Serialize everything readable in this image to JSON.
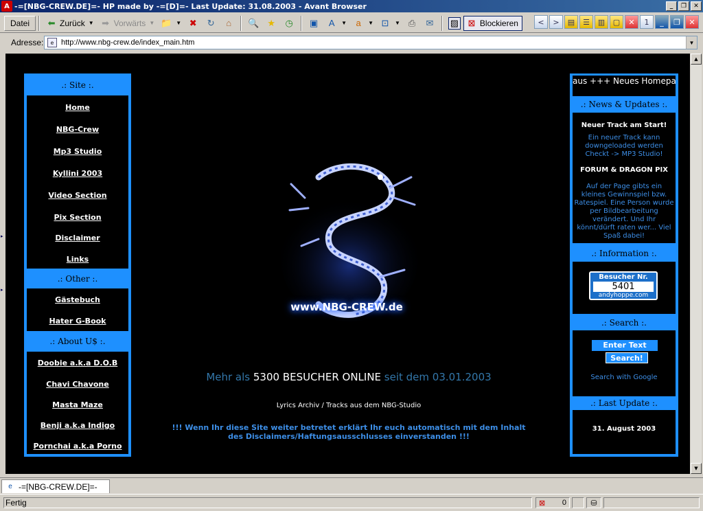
{
  "window": {
    "title": "-=[NBG-CREW.DE]=- HP made by -=[D]=- Last Update: 31.08.2003 - Avant Browser"
  },
  "toolbar": {
    "file_menu": "Datei",
    "back_label": "Zurück",
    "forward_label": "Vorwärts",
    "blocker_label": "Blockieren"
  },
  "address": {
    "label": "Adresse:",
    "url": "http://www.nbg-crew.de/index_main.htm"
  },
  "left_nav": {
    "site_header": ".: Site :.",
    "site_links": [
      "Home",
      "NBG-Crew",
      "Mp3 Studio",
      "Kyllini 2003",
      "Video Section",
      "Pix Section",
      "Disclaimer",
      "Links"
    ],
    "other_header": ".: Other :.",
    "other_links": [
      "Gästebuch",
      "Hater G-Book"
    ],
    "about_header": ".: About U$ :.",
    "about_links": [
      "Doobie a.k.a D.O.B",
      "Chavi Chavone",
      "Masta Maze",
      "Benji a.k.a Indigo",
      "Pornchai a.k.a Porno"
    ]
  },
  "center": {
    "logo_text": "www.NBG-CREW.de",
    "visitors_pre": "Mehr als ",
    "visitors_count": "5300 BESUCHER ONLINE",
    "visitors_post": " seit dem 03.01.2003",
    "lyrics_line": "Lyrics Archiv / Tracks aus dem NBG-Studio",
    "disclaimer_line": "!!! Wenn Ihr diese Site weiter betretet erklärt Ihr euch automatisch mit dem Inhalt des Disclaimers/Haftungsausschlusses einverstanden !!!"
  },
  "right_nav": {
    "marquee": "aus +++  Neues Homepa",
    "news_header": ".: News & Updates :.",
    "news": [
      {
        "heading": "Neuer Track am Start!",
        "text": "Ein neuer Track kann downgeloaded werden Checkt -> MP3 Studio!"
      },
      {
        "heading": "FORUM & DRAGON PIX",
        "text": "Auf der Page gibts ein kleines Gewinnspiel bzw. Ratespiel. Eine Person wurde per Bildbearbeitung verändert. Und Ihr könnt/dürft raten wer... Viel Spaß dabei!"
      }
    ],
    "info_header": ".: Information :.",
    "counter_top": "Besucher Nr.",
    "counter_value": "5401",
    "counter_bottom": "andyhoppe.com",
    "search_header": ".: Search :.",
    "search_placeholder": "Enter Text",
    "search_button": "Search!",
    "search_google": "Search with Google",
    "last_update_header": ".: Last Update :.",
    "last_update_value": "31. August 2003"
  },
  "tabs": {
    "active_tab": "-=[NBG-CREW.DE]=-"
  },
  "status": {
    "text": "Fertig",
    "blocked_count": "0"
  }
}
